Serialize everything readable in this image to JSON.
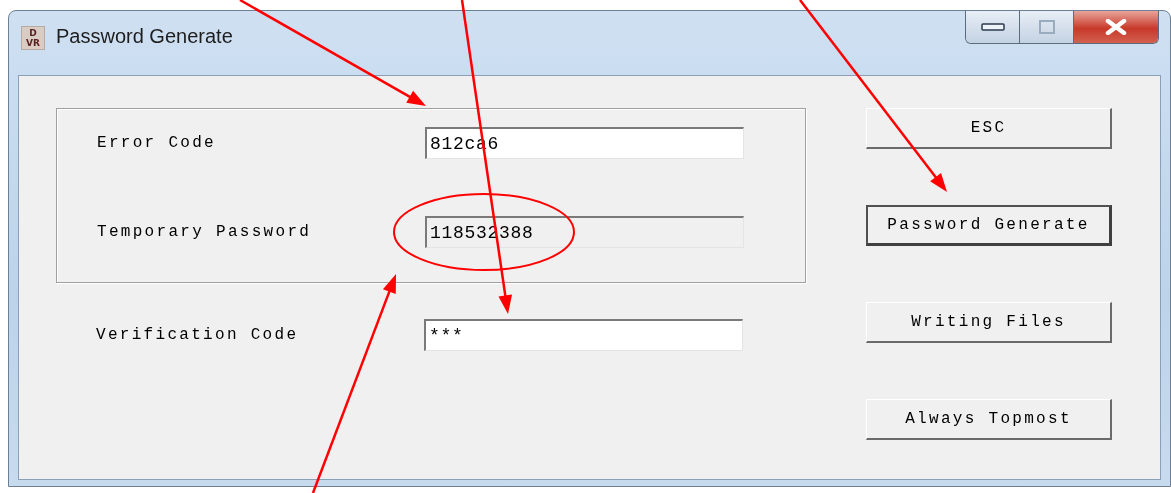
{
  "window": {
    "title": "Password Generate",
    "app_icon_text": [
      "D",
      "VR"
    ]
  },
  "group_fields": [
    {
      "label": "Error Code",
      "value": "812ca6",
      "readonly": false
    },
    {
      "label": "Temporary Password",
      "value": "118532388",
      "readonly": true
    }
  ],
  "verification": {
    "label": "Verification Code",
    "value": "***",
    "readonly": false
  },
  "buttons": [
    {
      "label": "ESC",
      "focused": false
    },
    {
      "label": "Password Generate",
      "focused": true
    },
    {
      "label": "Writing Files",
      "focused": false
    },
    {
      "label": "Always Topmost",
      "focused": false
    }
  ]
}
